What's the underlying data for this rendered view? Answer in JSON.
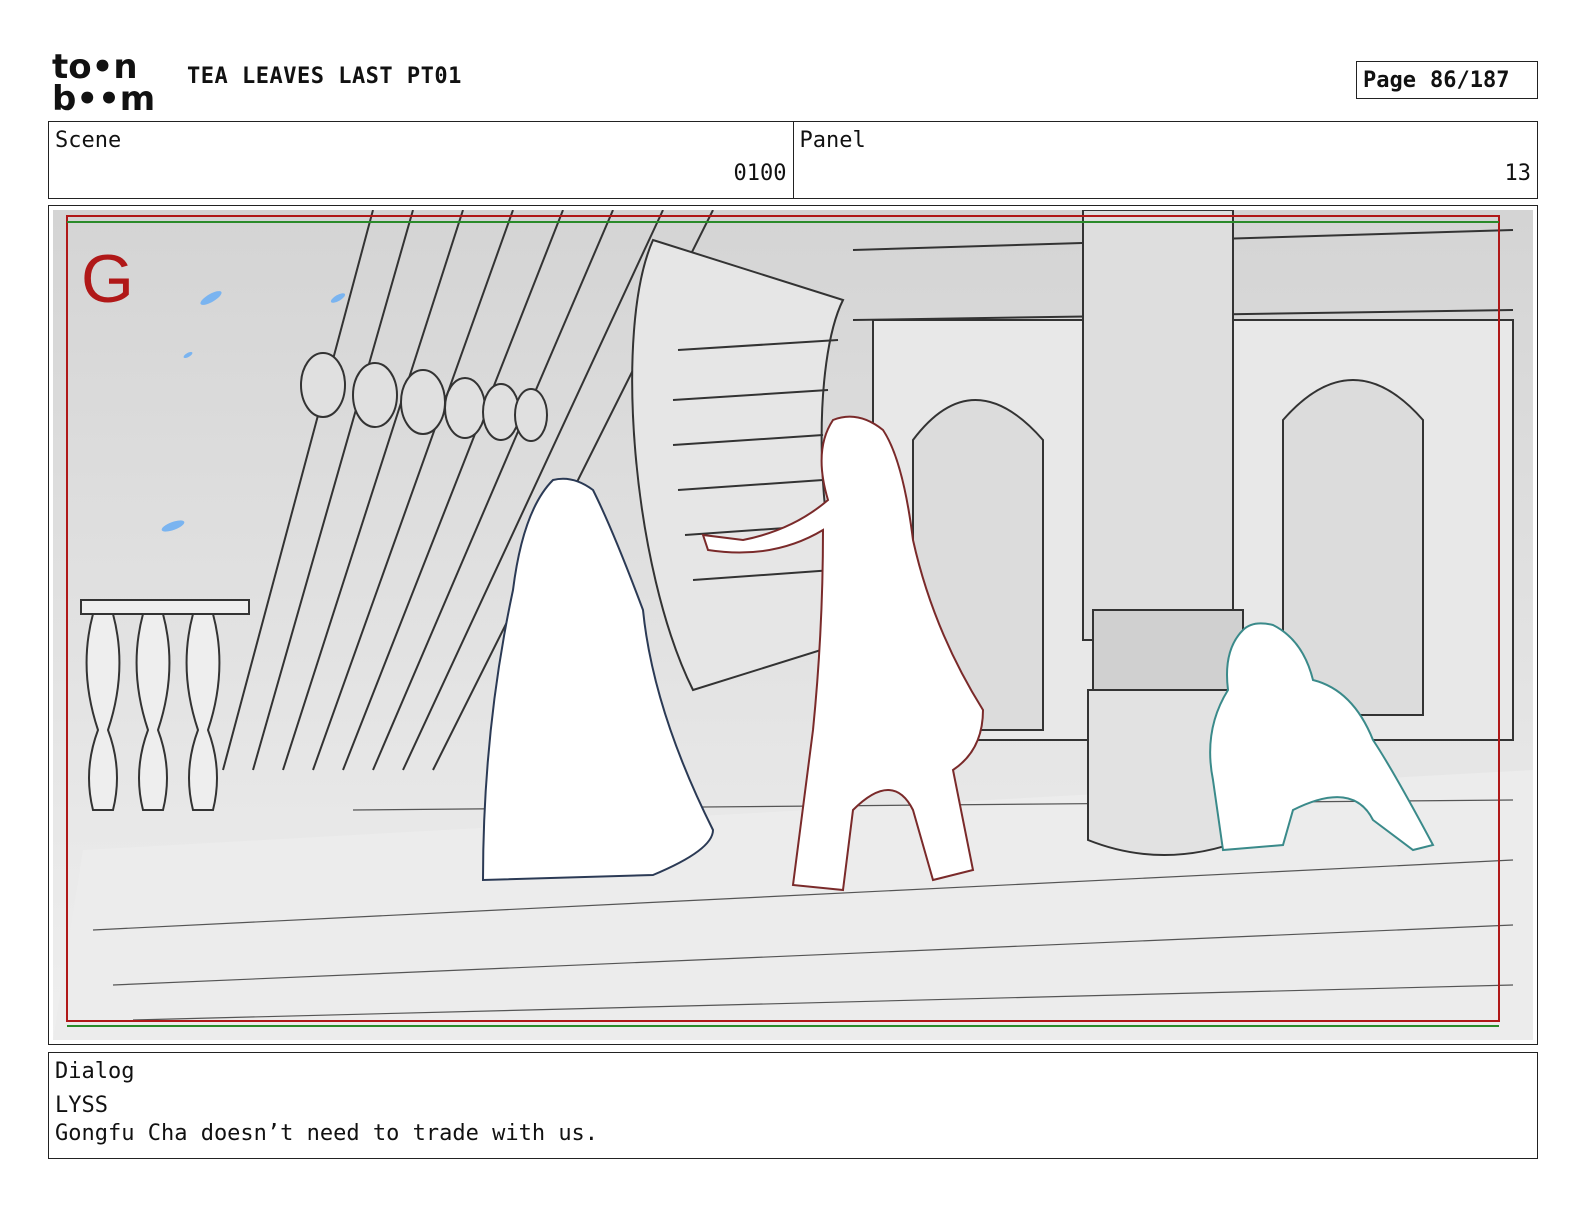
{
  "header": {
    "logo_top": "to•n",
    "logo_bottom": "b••m",
    "title": "TEA LEAVES LAST PT01",
    "page_label": "Page",
    "page_value": "86/187"
  },
  "info": {
    "scene_label": "Scene",
    "scene_value": "0100",
    "panel_label": "Panel",
    "panel_value": "13"
  },
  "frame": {
    "field_letter": "G",
    "colors": {
      "field_letter": "#b01818",
      "safe_frame_red": "#b01818",
      "safe_frame_green": "#2a8a2a",
      "character_left": "#2b3a55",
      "character_center": "#7a2a2a",
      "character_right": "#3a8a8a",
      "petals": "#7ab4f0",
      "sketch_lines": "#3a3a3a"
    }
  },
  "dialog": {
    "label": "Dialog",
    "speaker": "LYSS",
    "line": "Gongfu Cha doesn’t need to trade with us."
  }
}
